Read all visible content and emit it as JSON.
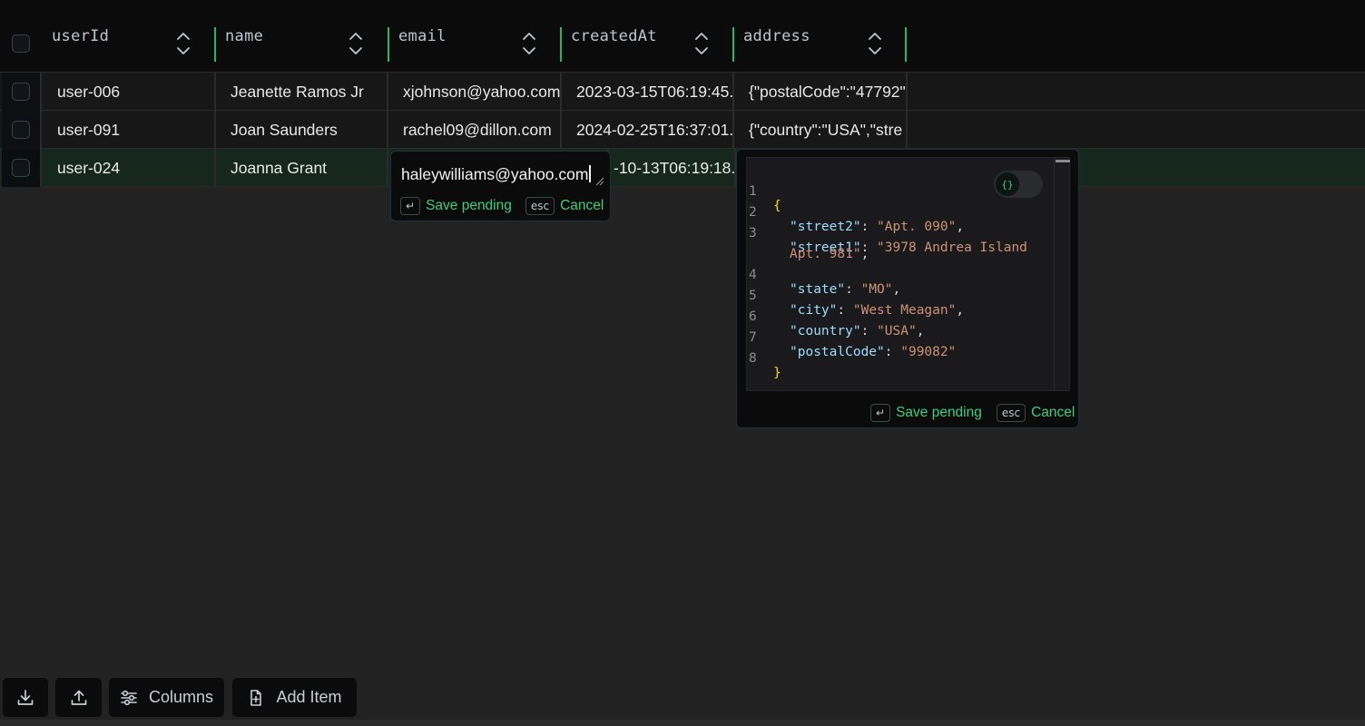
{
  "columns": [
    {
      "label": "userId"
    },
    {
      "label": "name"
    },
    {
      "label": "email"
    },
    {
      "label": "createdAt"
    },
    {
      "label": "address"
    }
  ],
  "rows": [
    {
      "userId": "user-006",
      "name": "Jeanette Ramos Jr",
      "email": "xjohnson@yahoo.com",
      "createdAt": "2023-03-15T06:19:45.",
      "address": "{\"postalCode\":\"47792\""
    },
    {
      "userId": "user-091",
      "name": "Joan Saunders",
      "email": "rachel09@dillon.com",
      "createdAt": "2024-02-25T16:37:01.",
      "address": "{\"country\":\"USA\",\"stre"
    },
    {
      "userId": "user-024",
      "name": "Joanna Grant",
      "email": "",
      "createdAt": "-10-13T06:19:18.",
      "address": ""
    }
  ],
  "email_editor": {
    "value": "haleywilliams@yahoo.com",
    "enter_key": "↵",
    "save_label": "Save pending",
    "esc_key": "esc",
    "cancel_label": "Cancel"
  },
  "json_editor": {
    "format_icon": "{}",
    "enter_key": "↵",
    "save_label": "Save pending",
    "esc_key": "esc",
    "cancel_label": "Cancel",
    "line_numbers": [
      "1",
      "2",
      "3",
      "4",
      "5",
      "6",
      "7",
      "8"
    ],
    "entries": [
      {
        "key": "\"street2\"",
        "value": "\"Apt. 090\""
      },
      {
        "key": "\"street1\"",
        "value": "\"3978 Andrea Island",
        "value_cont": "Apt. 981\""
      },
      {
        "key": "\"state\"",
        "value": "\"MO\""
      },
      {
        "key": "\"city\"",
        "value": "\"West Meagan\""
      },
      {
        "key": "\"country\"",
        "value": "\"USA\""
      },
      {
        "key": "\"postalCode\"",
        "value": "\"99082\""
      }
    ],
    "open_brace": "{",
    "close_brace": "}"
  },
  "footer": {
    "download_icon": "download-icon",
    "upload_icon": "upload-icon",
    "columns_label": "Columns",
    "add_item_label": "Add Item"
  },
  "colors": {
    "accent": "#22b573",
    "selected_row": "#16281d",
    "json_key": "#9cdcfe",
    "json_string": "#ce9178"
  }
}
